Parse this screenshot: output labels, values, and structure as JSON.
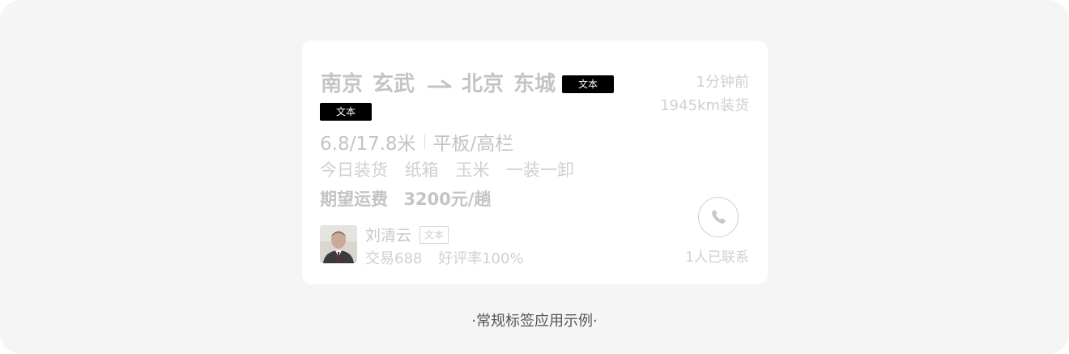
{
  "card": {
    "origin_city": "南京",
    "origin_district": "玄武",
    "dest_city": "北京",
    "dest_district": "东城",
    "tag_inline": "文本",
    "tag_second": "文本",
    "time_ago": "1分钟前",
    "distance": "1945km装货",
    "size": "6.8/17.8米",
    "truck_type": "平板/高栏",
    "goods": [
      "今日装货",
      "纸箱",
      "玉米",
      "一装一卸"
    ],
    "price_label": "期望运费",
    "price_value": "3200元/趟",
    "driver_name": "刘清云",
    "driver_tag": "文本",
    "trades": "交易688",
    "rating": "好评率100%",
    "contacts": "1人已联系"
  },
  "caption": "·常规标签应用示例·",
  "icons": {
    "route": "arrow-right-icon",
    "call": "phone-icon"
  },
  "colors": {
    "tag_bg": "#000000",
    "tag_text": "#ffffff",
    "muted_text": "#c4c4c4",
    "background": "#f5f5f5"
  }
}
